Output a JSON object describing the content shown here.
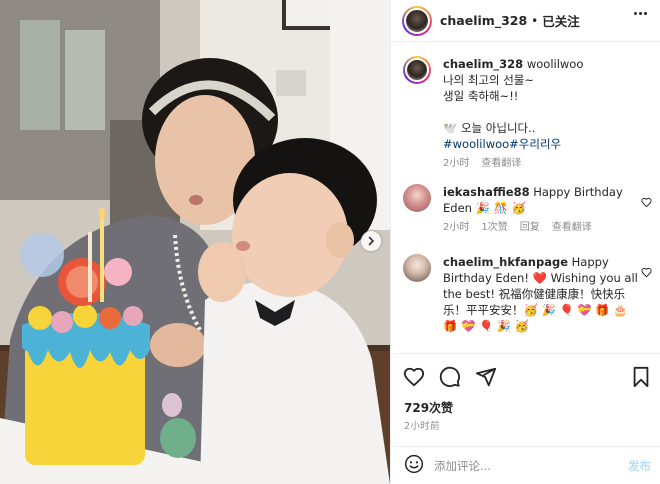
{
  "header": {
    "username": "chaelim_328",
    "separator": "•",
    "follow_status": "已关注"
  },
  "caption": {
    "username": "chaelim_328",
    "lines": [
      "woolilwoo",
      "나의 최고의 선물~",
      "생일 축하해~!!",
      "",
      "🕊️ 오늘 아닙니다..",
      "#woolilwoo#우리리우"
    ],
    "time": "2小时",
    "translate": "查看翻译"
  },
  "comments": [
    {
      "username": "iekashaffie88",
      "text": "Happy Birthday Eden 🎉 🎊 🥳",
      "time": "2小时",
      "likes": "1次赞",
      "reply": "回复",
      "translate": "查看翻译"
    },
    {
      "username": "chaelim_hkfanpage",
      "text": "Happy Birthday Eden! ❤️ Wishing you all the best! 祝福你健健康康！快快乐乐！平平安安！🥳 🎉 🎈 💝 🎁 🎂 🎁 💝 🎈 🎉 🥳"
    }
  ],
  "actions": {
    "likes": "729次赞",
    "posted": "2小时前"
  },
  "comment_box": {
    "placeholder": "添加评论...",
    "post_label": "发布"
  },
  "icons": {
    "more": "more-horizontal-icon",
    "heart": "heart-icon",
    "comment": "comment-icon",
    "share": "share-icon",
    "save": "bookmark-icon",
    "emoji": "emoji-icon",
    "next": "chevron-right-icon"
  }
}
